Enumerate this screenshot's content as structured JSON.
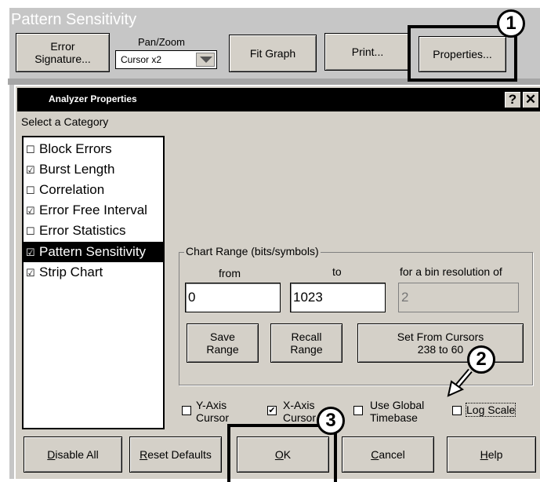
{
  "background_window": {
    "title": "Pattern Sensitivity",
    "error_signature_button": "Error\nSignature...",
    "pan_zoom_label": "Pan/Zoom",
    "pan_zoom_value": "Cursor x2",
    "fit_graph_button": "Fit Graph",
    "print_button": "Print...",
    "properties_button": "Properties..."
  },
  "dialog": {
    "title": "Analyzer Properties",
    "help_glyph": "?",
    "close_glyph": "✕",
    "category_label": "Select a Category",
    "categories": [
      {
        "label": "Block Errors",
        "checked": false,
        "selected": false
      },
      {
        "label": "Burst Length",
        "checked": true,
        "selected": false
      },
      {
        "label": "Correlation",
        "checked": false,
        "selected": false
      },
      {
        "label": "Error Free Interval",
        "checked": true,
        "selected": false
      },
      {
        "label": "Error Statistics",
        "checked": false,
        "selected": false
      },
      {
        "label": "Pattern Sensitivity",
        "checked": true,
        "selected": true
      },
      {
        "label": "Strip Chart",
        "checked": true,
        "selected": false
      }
    ],
    "chart_range": {
      "group_label": "Chart Range (bits/symbols)",
      "from_label": "from",
      "to_label": "to",
      "bin_label": "for a bin resolution of",
      "from_value": "0",
      "to_value": "1023",
      "bin_value": "2",
      "save_range_button": "Save\nRange",
      "recall_range_button": "Recall\nRange",
      "set_from_cursors_button": "Set From Cursors\n238 to 60"
    },
    "options": {
      "y_axis_cursor": {
        "label": "Y-Axis\nCursor",
        "checked": false
      },
      "x_axis_cursor": {
        "label": "X-Axis\nCursor",
        "checked": true
      },
      "use_global_timebase": {
        "label": "Use Global\nTimebase",
        "checked": false
      },
      "log_scale": {
        "label": "Log Scale",
        "checked": false
      }
    },
    "buttons": {
      "disable_all_mnemonic": "D",
      "disable_all_rest": "isable All",
      "reset_defaults_mnemonic": "R",
      "reset_defaults_rest": "eset Defaults",
      "ok_mnemonic": "O",
      "ok_rest": "K",
      "cancel_mnemonic": "C",
      "cancel_rest": "ancel",
      "help_mnemonic": "H",
      "help_rest": "elp"
    }
  },
  "callouts": [
    "1",
    "2",
    "3"
  ],
  "check_glyph": "☑",
  "uncheck_glyph": "☐",
  "box_check_glyph": "✔",
  "colors": {
    "window_gray": "#c6c6c6",
    "dialog_gray": "#d4d0c8",
    "selection": "#000000"
  }
}
